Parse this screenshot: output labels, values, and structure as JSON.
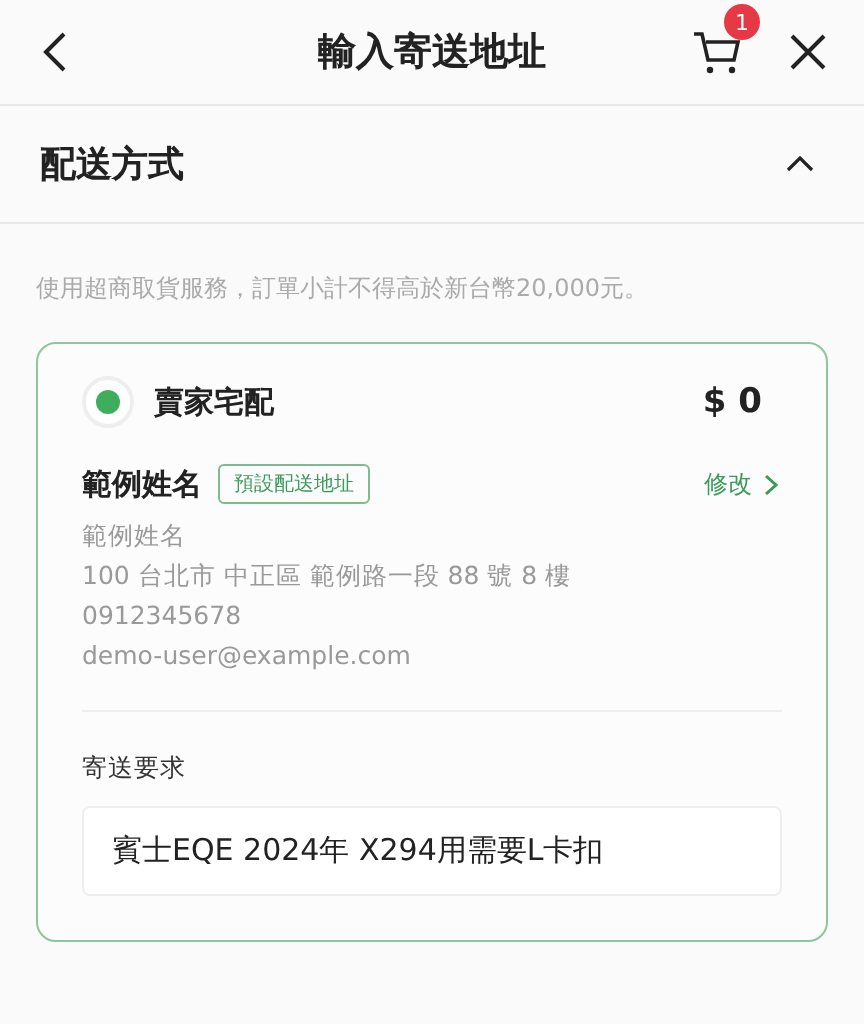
{
  "header": {
    "title": "輸入寄送地址",
    "cart_badge": "1"
  },
  "section": {
    "title": "配送方式",
    "expanded": true
  },
  "note": "使用超商取貨服務，訂單小計不得高於新台幣20,000元。",
  "option": {
    "label": "賣家宅配",
    "selected": true,
    "price": "$ 0"
  },
  "recipient": {
    "name": "範例姓名",
    "badge": "預設配送地址",
    "edit_link": "修改",
    "lines": [
      "範例姓名",
      "100 台北市 中正區 範例路一段 88 號 8 樓",
      "0912345678",
      "demo-user@example.com"
    ]
  },
  "request": {
    "label": "寄送要求",
    "value": "賓士EQE 2024年 X294用需要L卡扣"
  }
}
